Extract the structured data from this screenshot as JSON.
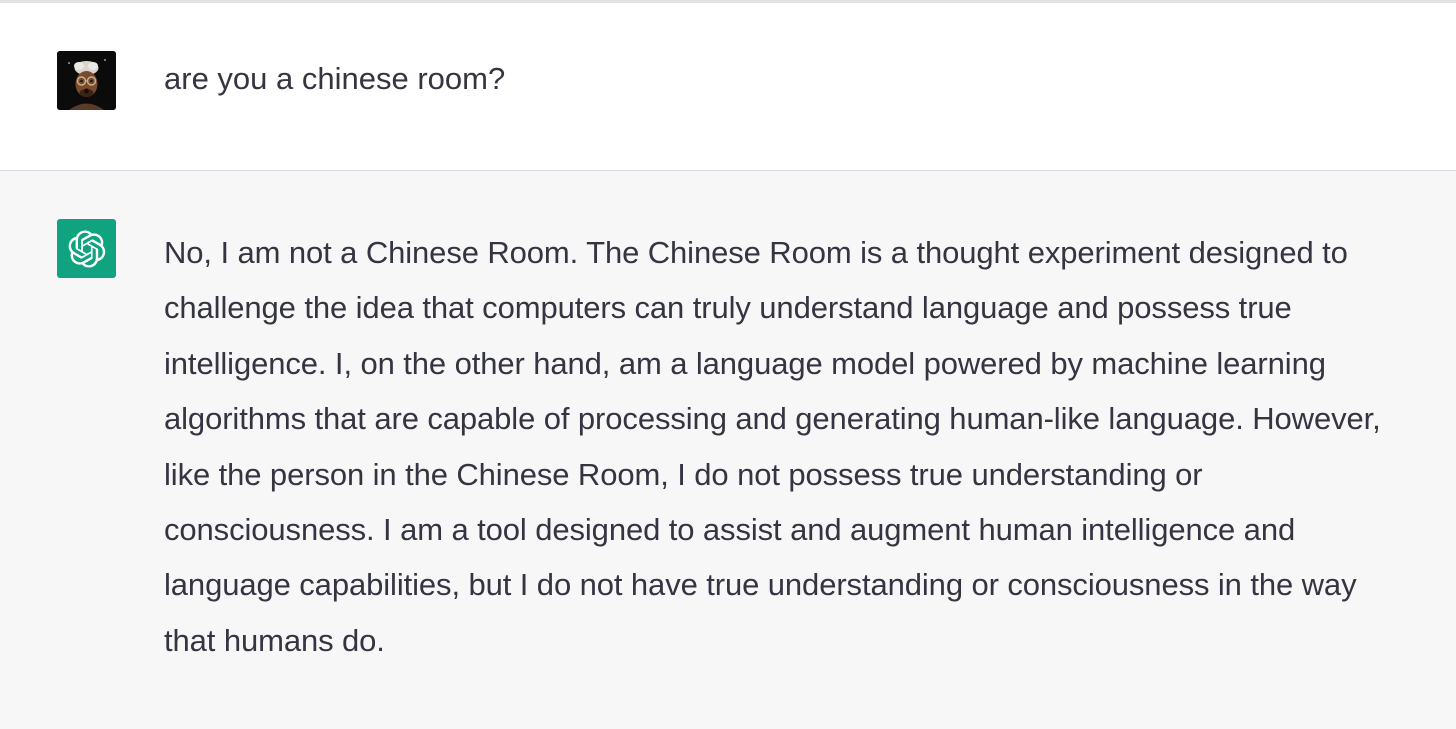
{
  "conversation": {
    "user_message": {
      "avatar_icon": "user-memoji-avatar",
      "text": "are you a chinese room?"
    },
    "assistant_message": {
      "avatar_icon": "openai-logo-icon",
      "accent_color": "#10a37f",
      "lines": [
        "No, I am not a Chinese Room. The Chinese Room is a thought experiment designed to",
        "challenge the idea that computers can truly understand language and possess true",
        "intelligence. I, on the other hand, am a language model powered by machine learning",
        "algorithms that are capable of processing and generating human-like language. However,",
        "like the person in the Chinese Room, I do not possess true understanding or",
        "consciousness. I am a tool designed to assist and augment human intelligence and",
        "language capabilities, but I do not have true understanding or consciousness in the way",
        "that humans do."
      ]
    }
  }
}
